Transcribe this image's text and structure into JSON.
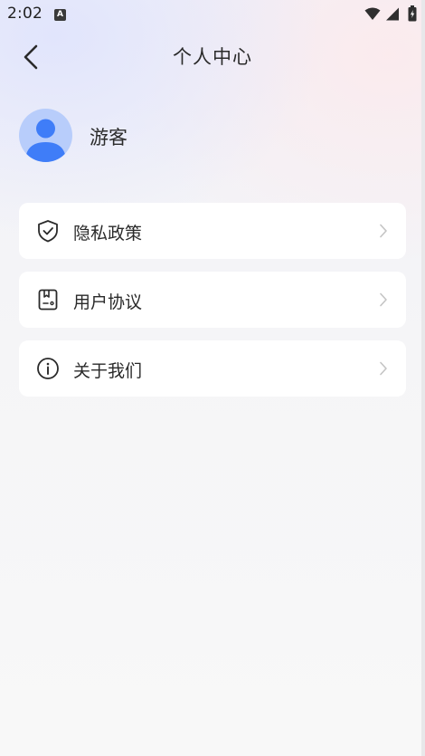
{
  "status_bar": {
    "time": "2:02",
    "notification_glyph": "A",
    "icons": [
      "wifi-icon",
      "signal-icon",
      "battery-icon"
    ]
  },
  "header": {
    "title": "个人中心",
    "back_icon": "chevron-left-icon"
  },
  "profile": {
    "avatar_icon": "user-avatar-icon",
    "name": "游客"
  },
  "menu": {
    "items": [
      {
        "label": "隐私政策",
        "icon": "shield-check-icon"
      },
      {
        "label": "用户协议",
        "icon": "document-icon"
      },
      {
        "label": "关于我们",
        "icon": "info-circle-icon"
      }
    ]
  },
  "colors": {
    "accent": "#3f7df8",
    "avatar_bg": "#b8cdfb",
    "card_bg": "#ffffff",
    "text": "#2a2a2a",
    "chevron": "#c4c4c4"
  }
}
